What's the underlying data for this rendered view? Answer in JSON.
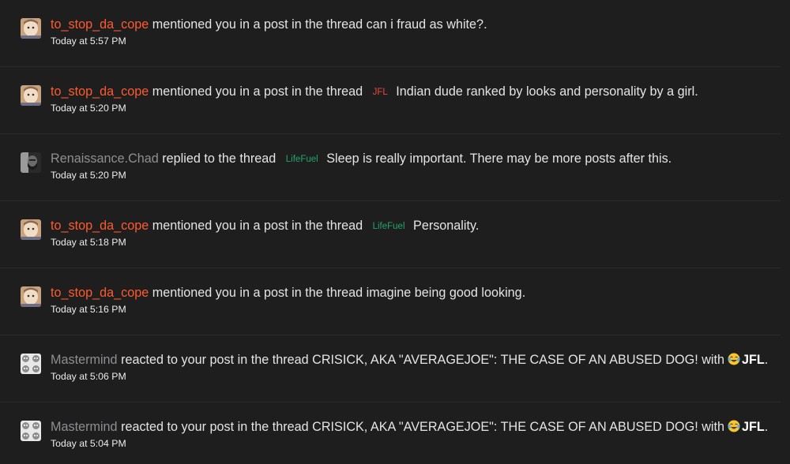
{
  "alerts": [
    {
      "avatar_icon": "cartoon-face-avatar",
      "user": "to_stop_da_cope",
      "action": "mentioned you in a post in the thread",
      "prefix": "",
      "title": "can i fraud as white?.",
      "time": "Today at 5:57 PM"
    },
    {
      "avatar_icon": "cartoon-face-avatar",
      "user": "to_stop_da_cope",
      "action": "mentioned you in a post in the thread",
      "prefix": "JFL",
      "title": "Indian dude ranked by looks and personality by a girl.",
      "time": "Today at 5:20 PM"
    },
    {
      "avatar_icon": "bearded-man-avatar",
      "user": "Renaissance.Chad",
      "action": "replied to the thread",
      "prefix": "LifeFuel",
      "title": "Sleep is really important. There may be more posts after this.",
      "time": "Today at 5:20 PM"
    },
    {
      "avatar_icon": "cartoon-face-avatar",
      "user": "to_stop_da_cope",
      "action": "mentioned you in a post in the thread",
      "prefix": "LifeFuel",
      "title": "Personality.",
      "time": "Today at 5:18 PM"
    },
    {
      "avatar_icon": "cartoon-face-avatar",
      "user": "to_stop_da_cope",
      "action": "mentioned you in a post in the thread",
      "prefix": "",
      "title": "imagine being good looking.",
      "time": "Today at 5:16 PM"
    },
    {
      "avatar_icon": "skull-grid-avatar",
      "user": "Mastermind",
      "action": "reacted to your post in the thread",
      "title": "CRISICK, AKA \"AVERAGEJOE\": THE CASE OF AN ABUSED DOG!",
      "with_text": "with",
      "reaction_icon": "crying-laughing-emoji",
      "reaction": "JFL",
      "period": ".",
      "time": "Today at 5:06 PM"
    },
    {
      "avatar_icon": "skull-grid-avatar",
      "user": "Mastermind",
      "action": "reacted to your post in the thread",
      "title": "CRISICK, AKA \"AVERAGEJOE\": THE CASE OF AN ABUSED DOG!",
      "with_text": "with",
      "reaction_icon": "crying-laughing-emoji",
      "reaction": "JFL",
      "period": ".",
      "time": "Today at 5:04 PM"
    }
  ]
}
